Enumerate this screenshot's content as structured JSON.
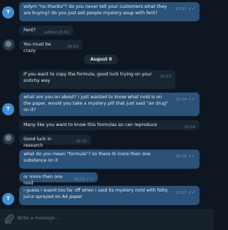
{
  "messages": {
    "m1": {
      "text": "wdym \"no thanks\"? do you never tell your customers what they are buying? do you just sell people mystery soup with fent?",
      "time": "13:37"
    },
    "m2": {
      "text": "Fent?",
      "status": "edited 20:01"
    },
    "m3": {
      "text": "You must be crazy",
      "time": "20:01"
    },
    "m4": {
      "text": "If you want to copy the formula, good luck trying on your snitchy way",
      "time": "15:13"
    },
    "m5": {
      "text": "what are you on about? i just wanted to know what noid is on the paper, would you take a mystery pill that just said \"an drug\" on it?",
      "time": "15:14"
    },
    "m6": {
      "text": "Many like you want to know this formulas so can reproduce",
      "time": "15:14"
    },
    "m7": {
      "text": "Good luck in research",
      "time": "15:15"
    },
    "m8": {
      "text": "what do you mean \"formula\"? so there IS more then one substence on it",
      "time": "15:15"
    },
    "m9": {
      "text": "or more then one noid",
      "time": "15:15"
    },
    "m10": {
      "text": "i guess i wasnt too far off when i said its mystery noid with fetty juice sprayed on A4 paper",
      "time": "15:17"
    }
  },
  "date_separator": "August 8",
  "avatar_initial": "T",
  "compose": {
    "placeholder": "Write a message..."
  },
  "colors": {
    "background": "#0e1621",
    "outgoing": "#2b5278",
    "incoming": "#182533",
    "accent": "#3e8fd8"
  },
  "icons": {
    "attach": "paperclip-icon",
    "read": "double-check-icon"
  }
}
